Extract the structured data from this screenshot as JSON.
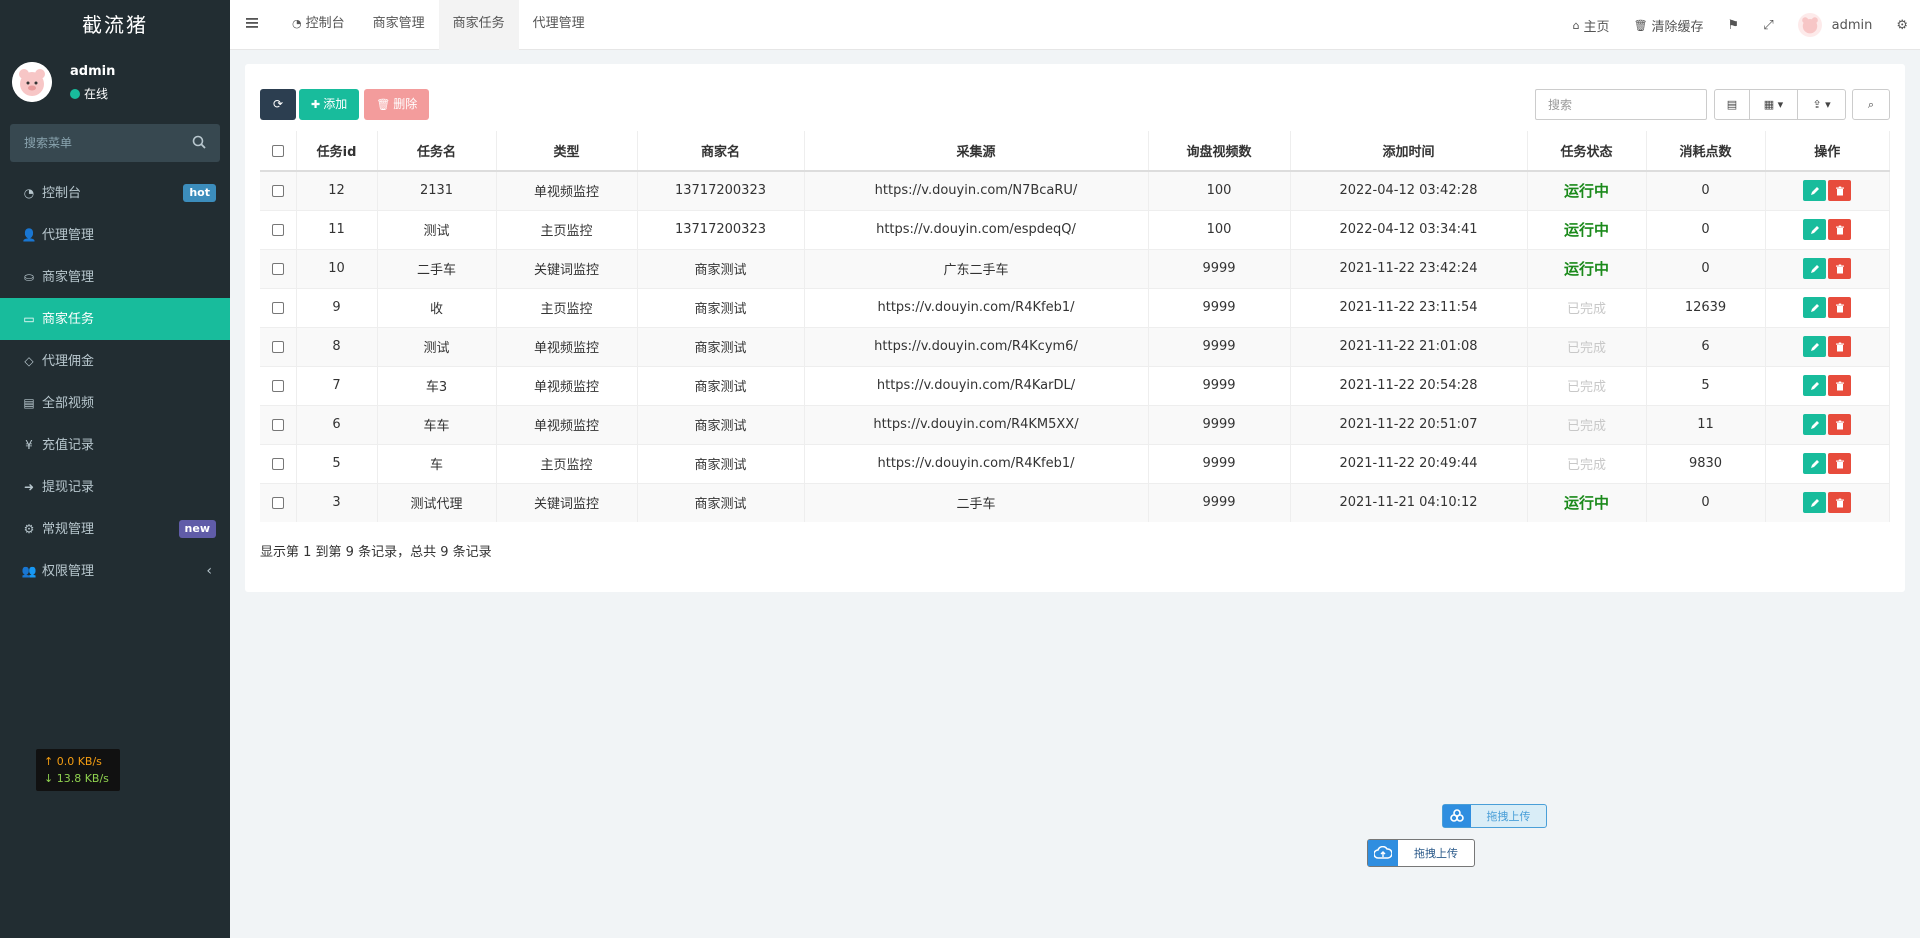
{
  "app": {
    "logo": "截流猪"
  },
  "user": {
    "name": "admin",
    "status": "在线"
  },
  "sidebar": {
    "search_placeholder": "搜索菜单",
    "items": [
      {
        "label": "控制台",
        "icon": "dashboard-icon",
        "badge": "hot"
      },
      {
        "label": "代理管理",
        "icon": "user-plus-icon"
      },
      {
        "label": "商家管理",
        "icon": "handshake-icon"
      },
      {
        "label": "商家任务",
        "icon": "battery-icon",
        "active": true
      },
      {
        "label": "代理佣金",
        "icon": "diamond-icon"
      },
      {
        "label": "全部视频",
        "icon": "file-icon"
      },
      {
        "label": "充值记录",
        "icon": "yen-icon"
      },
      {
        "label": "提现记录",
        "icon": "sign-in-icon"
      },
      {
        "label": "常规管理",
        "icon": "cogs-icon",
        "badge": "new"
      },
      {
        "label": "权限管理",
        "icon": "group-icon"
      }
    ]
  },
  "netspeed": {
    "up": "↑ 0.0 KB/s",
    "down": "↓ 13.8 KB/s"
  },
  "topnav": {
    "tabs": [
      {
        "label": "控制台",
        "icon": "dashboard-icon"
      },
      {
        "label": "商家管理"
      },
      {
        "label": "商家任务",
        "active": true
      },
      {
        "label": "代理管理"
      }
    ],
    "home": "主页",
    "clear_cache": "清除缓存",
    "admin": "admin"
  },
  "toolbar": {
    "add": "添加",
    "delete": "删除",
    "search_placeholder": "搜索"
  },
  "table": {
    "headers": [
      "任务id",
      "任务名",
      "类型",
      "商家名",
      "采集源",
      "询盘视频数",
      "添加时间",
      "任务状态",
      "消耗点数",
      "操作"
    ],
    "rows": [
      {
        "id": "12",
        "name": "2131",
        "type": "单视频监控",
        "merchant": "13717200323",
        "source": "https://v.douyin.com/N7BcaRU/",
        "count": "100",
        "time": "2022-04-12 03:42:28",
        "status": "运行中",
        "running": true,
        "points": "0"
      },
      {
        "id": "11",
        "name": "测试",
        "type": "主页监控",
        "merchant": "13717200323",
        "source": "https://v.douyin.com/espdeqQ/",
        "count": "100",
        "time": "2022-04-12 03:34:41",
        "status": "运行中",
        "running": true,
        "points": "0"
      },
      {
        "id": "10",
        "name": "二手车",
        "type": "关键词监控",
        "merchant": "商家测试",
        "source": "广东二手车",
        "count": "9999",
        "time": "2021-11-22 23:42:24",
        "status": "运行中",
        "running": true,
        "points": "0"
      },
      {
        "id": "9",
        "name": "收",
        "type": "主页监控",
        "merchant": "商家测试",
        "source": "https://v.douyin.com/R4Kfeb1/",
        "count": "9999",
        "time": "2021-11-22 23:11:54",
        "status": "已完成",
        "running": false,
        "points": "12639"
      },
      {
        "id": "8",
        "name": "测试",
        "type": "单视频监控",
        "merchant": "商家测试",
        "source": "https://v.douyin.com/R4Kcym6/",
        "count": "9999",
        "time": "2021-11-22 21:01:08",
        "status": "已完成",
        "running": false,
        "points": "6"
      },
      {
        "id": "7",
        "name": "车3",
        "type": "单视频监控",
        "merchant": "商家测试",
        "source": "https://v.douyin.com/R4KarDL/",
        "count": "9999",
        "time": "2021-11-22 20:54:28",
        "status": "已完成",
        "running": false,
        "points": "5"
      },
      {
        "id": "6",
        "name": "车车",
        "type": "单视频监控",
        "merchant": "商家测试",
        "source": "https://v.douyin.com/R4KM5XX/",
        "count": "9999",
        "time": "2021-11-22 20:51:07",
        "status": "已完成",
        "running": false,
        "points": "11"
      },
      {
        "id": "5",
        "name": "车",
        "type": "主页监控",
        "merchant": "商家测试",
        "source": "https://v.douyin.com/R4Kfeb1/",
        "count": "9999",
        "time": "2021-11-22 20:49:44",
        "status": "已完成",
        "running": false,
        "points": "9830"
      },
      {
        "id": "3",
        "name": "测试代理",
        "type": "关键词监控",
        "merchant": "商家测试",
        "source": "二手车",
        "count": "9999",
        "time": "2021-11-21 04:10:12",
        "status": "运行中",
        "running": true,
        "points": "0"
      }
    ]
  },
  "pagination": {
    "info": "显示第 1 到第 9 条记录，总共 9 条记录"
  },
  "upload": {
    "label1": "拖拽上传",
    "label2": "拖拽上传"
  },
  "colors": {
    "accent": "#18bc9c",
    "sidebar": "#222d32",
    "danger": "#e74c3c",
    "running": "#1b8a1b"
  }
}
